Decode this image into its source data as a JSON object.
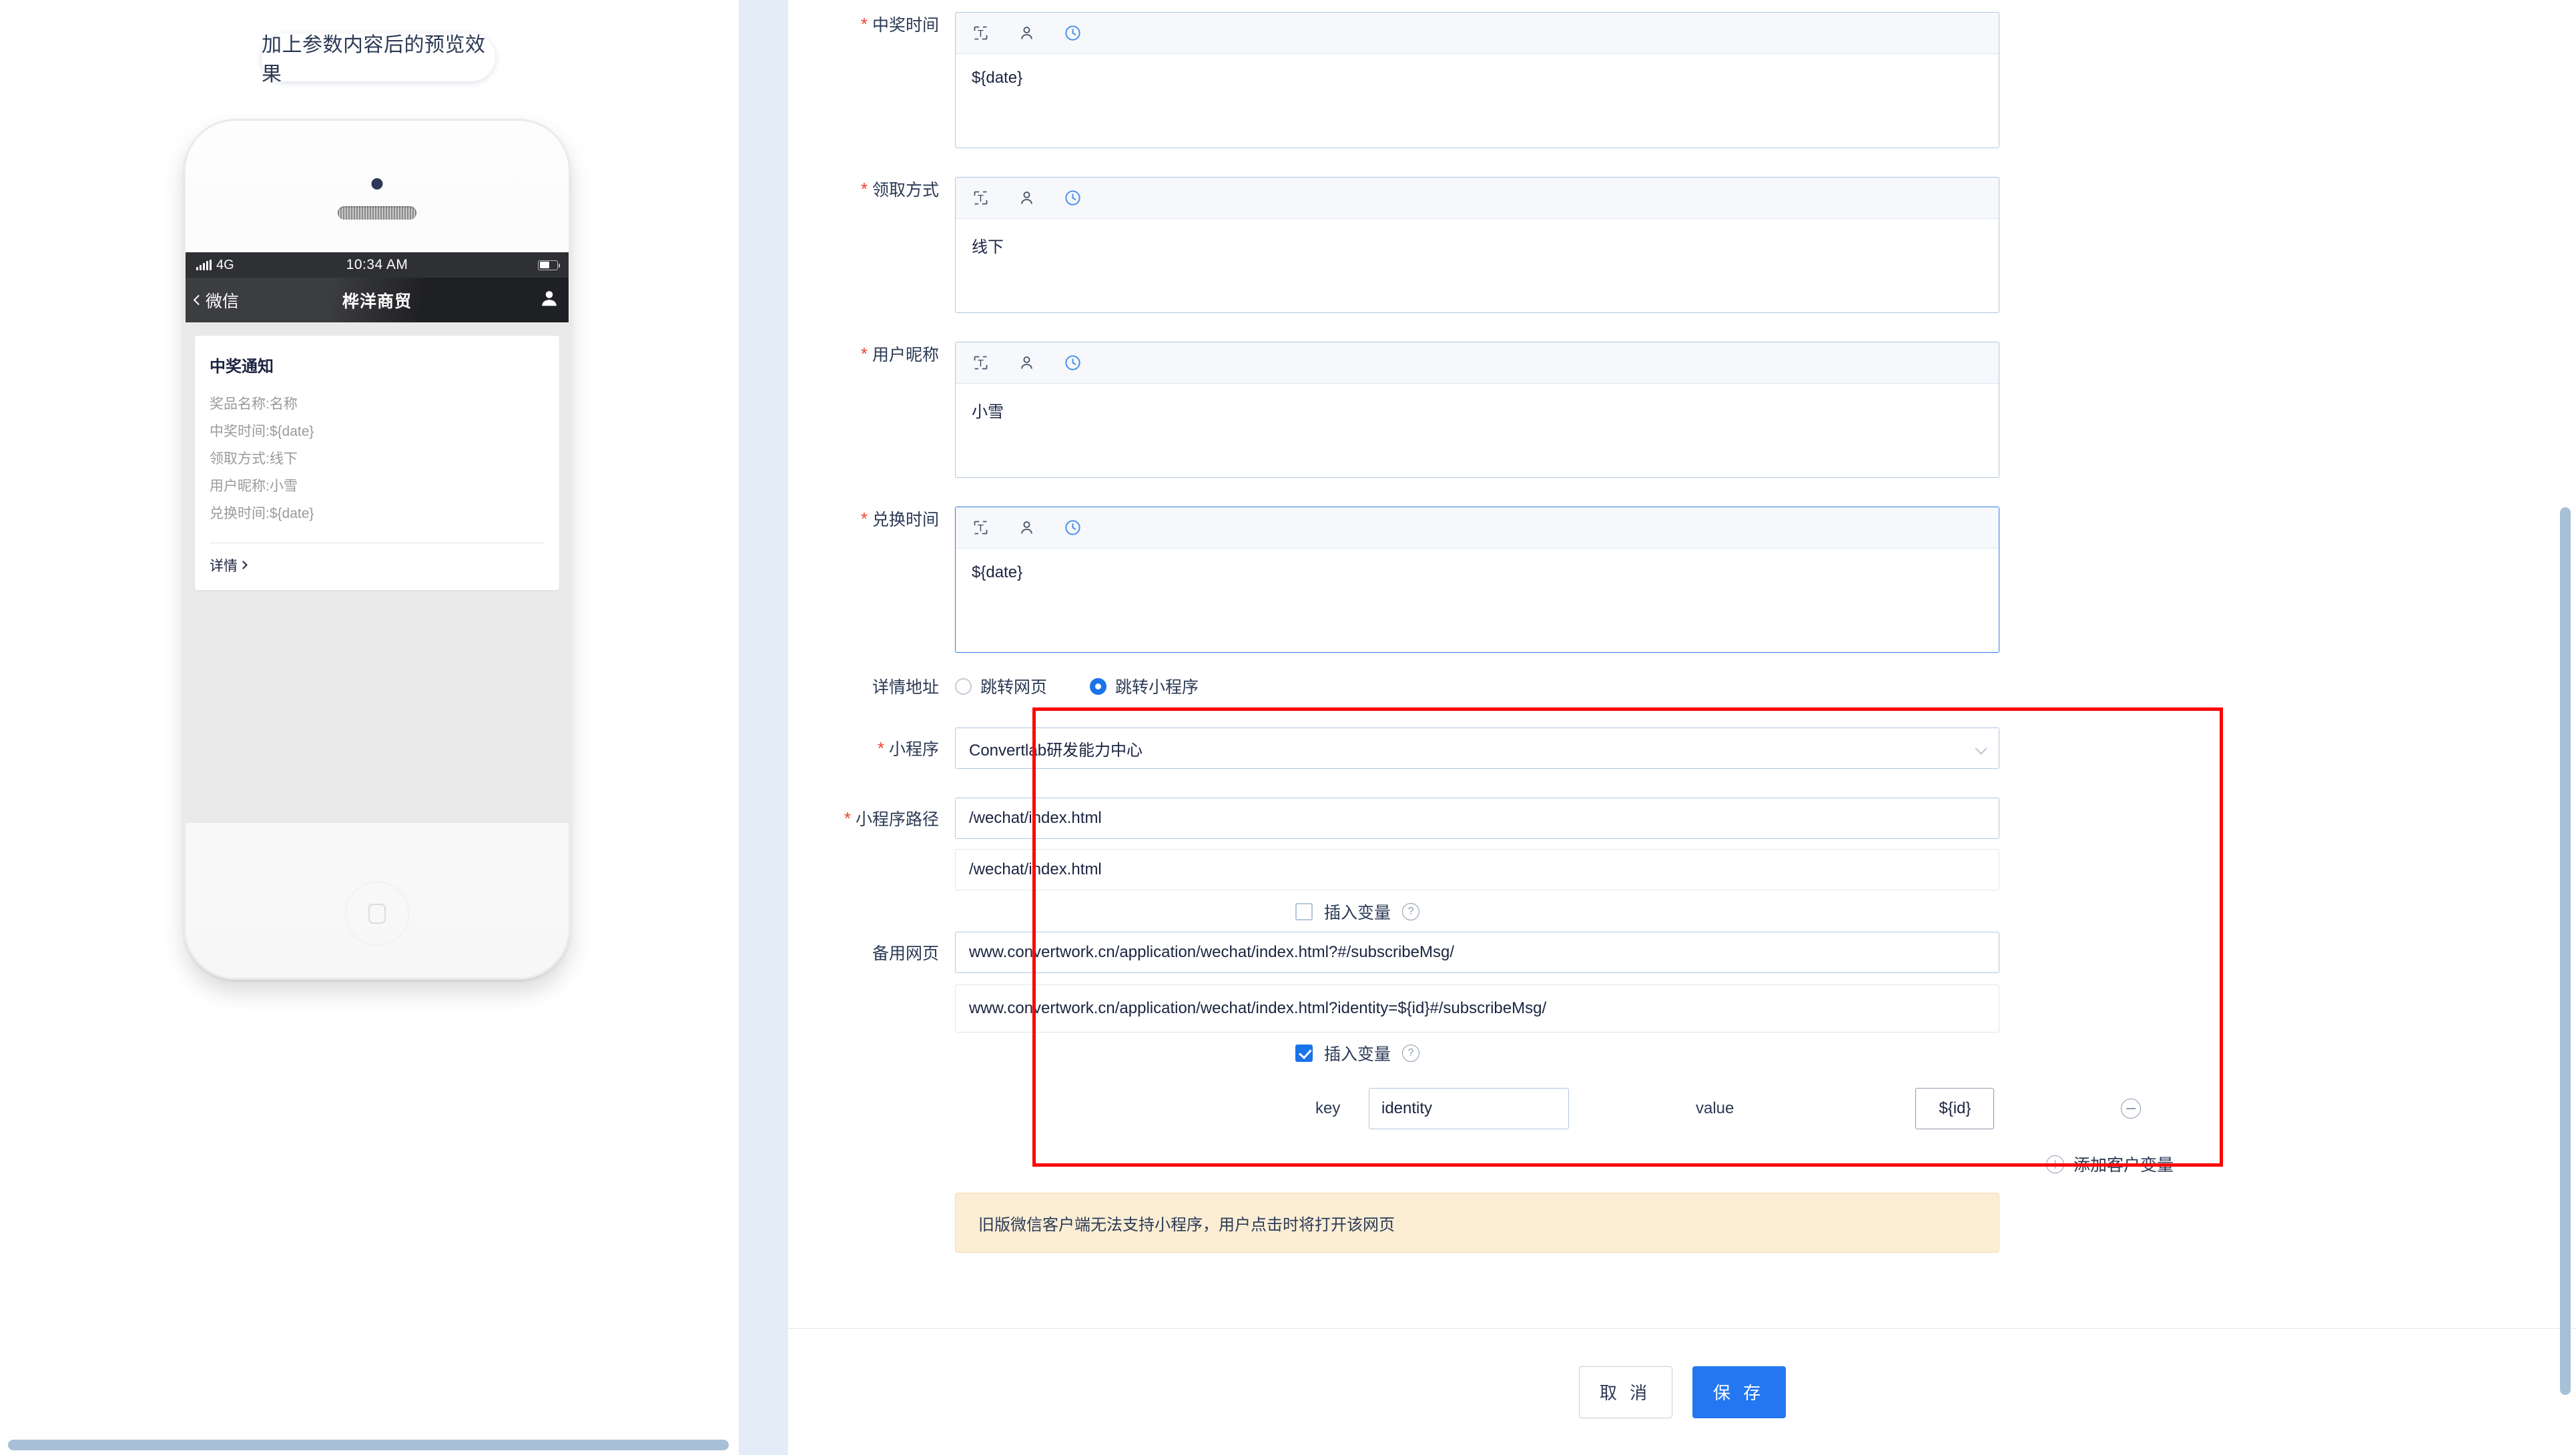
{
  "preview": {
    "badge_label": "加上参数内容后的预览效果",
    "phone": {
      "status_bar": {
        "network": "4G",
        "time": "10:34 AM"
      },
      "nav": {
        "back_label": "微信",
        "title": "桦洋商贸",
        "avatar_icon": "user-avatar-icon"
      },
      "card": {
        "title": "中奖通知",
        "lines": [
          "奖品名称:名称",
          "中奖时间:${date}",
          "领取方式:线下",
          "用户昵称:小雪",
          "兑换时间:${date}"
        ],
        "more_label": "详情"
      }
    }
  },
  "form": {
    "editor_fields": [
      {
        "label": "中奖时间",
        "required": true,
        "value": "${date}"
      },
      {
        "label": "领取方式",
        "required": true,
        "value": "线下"
      },
      {
        "label": "用户昵称",
        "required": true,
        "value": "小雪"
      },
      {
        "label": "兑换时间",
        "required": true,
        "value": "${date}"
      }
    ],
    "toolbar_icons": [
      "insert-text-variable-icon",
      "user-variable-icon",
      "date-variable-icon"
    ],
    "detail_address": {
      "label": "详情地址",
      "options": [
        {
          "label": "跳转网页",
          "selected": false
        },
        {
          "label": "跳转小程序",
          "selected": true
        }
      ]
    },
    "miniprogram": {
      "label": "小程序",
      "required": true,
      "value": "Convertlab研发能力中心",
      "chevron_icon": "chevron-down-icon"
    },
    "miniprogram_path": {
      "label": "小程序路径",
      "required": true,
      "value": "/wechat/index.html",
      "preview_value": "/wechat/index.html",
      "insert_var_label": "插入变量",
      "insert_var_checked": false,
      "help_icon": "question-mark-icon"
    },
    "backup_page": {
      "label": "备用网页",
      "required": false,
      "value": "www.convertwork.cn/application/wechat/index.html?#/subscribeMsg/",
      "preview_value": "www.convertwork.cn/application/wechat/index.html?identity=${id}#/subscribeMsg/",
      "insert_var_label": "插入变量",
      "insert_var_checked": true,
      "help_icon": "question-mark-icon",
      "variables": [
        {
          "key_label": "key",
          "key_value": "identity",
          "value_label": "value",
          "value_value": "${id}",
          "remove_icon": "minus-circle-icon"
        }
      ],
      "add_variable_label": "添加客户变量",
      "add_icon": "plus-circle-icon"
    },
    "warning_text": "旧版微信客户端无法支持小程序，用户点击时将打开该网页"
  },
  "footer": {
    "cancel_label": "取 消",
    "save_label": "保 存"
  },
  "colors": {
    "accent": "#2477f0",
    "required_star": "#f04134",
    "highlight_box": "#ff0000",
    "warning_bg": "#fbeed5",
    "gutter": "#e4ecf8",
    "scrollbar": "#a7c0d8"
  }
}
